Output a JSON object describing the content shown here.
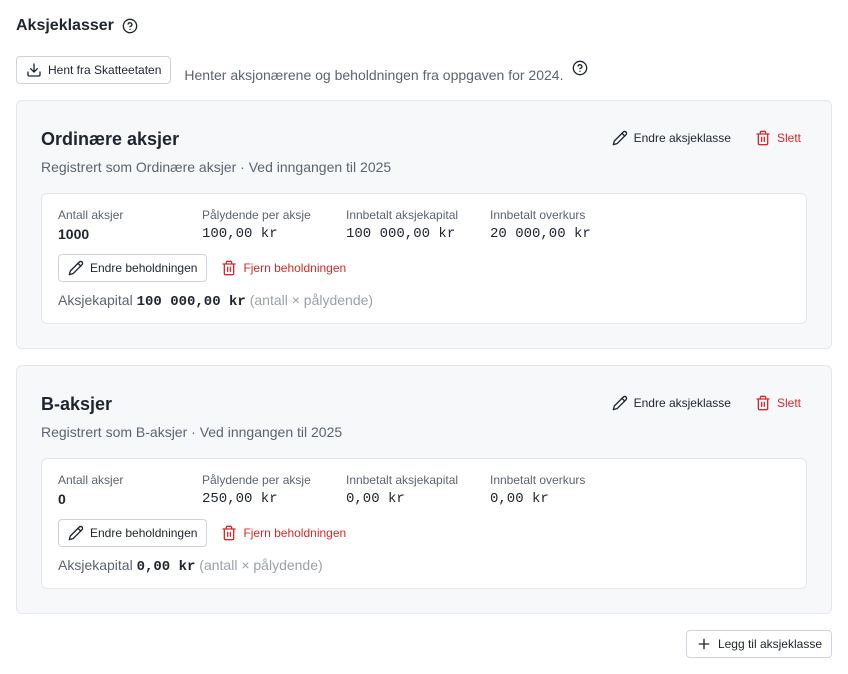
{
  "header": {
    "title": "Aksjeklasser"
  },
  "fetch": {
    "button_label": "Hent fra Skatteetaten",
    "description": "Henter aksjonærene og beholdningen fra oppgaven for 2024."
  },
  "share_classes": [
    {
      "title": "Ordinære aksjer",
      "subtitle": "Registrert som Ordinære aksjer · Ved inngangen til 2025",
      "edit_label": "Endre aksjeklasse",
      "delete_label": "Slett",
      "fields": {
        "count_label": "Antall aksjer",
        "count_value": "1000",
        "par_label": "Pålydende per aksje",
        "par_value": "100,00 kr",
        "paid_capital_label": "Innbetalt aksjekapital",
        "paid_capital_value": "100 000,00 kr",
        "premium_label": "Innbetalt overkurs",
        "premium_value": "20 000,00 kr"
      },
      "edit_holding_label": "Endre beholdningen",
      "remove_holding_label": "Fjern beholdningen",
      "capital_label": "Aksjekapital",
      "capital_value": "100 000,00 kr",
      "capital_note": "(antall × pålydende)"
    },
    {
      "title": "B-aksjer",
      "subtitle": "Registrert som B-aksjer · Ved inngangen til 2025",
      "edit_label": "Endre aksjeklasse",
      "delete_label": "Slett",
      "fields": {
        "count_label": "Antall aksjer",
        "count_value": "0",
        "par_label": "Pålydende per aksje",
        "par_value": "250,00 kr",
        "paid_capital_label": "Innbetalt aksjekapital",
        "paid_capital_value": "0,00 kr",
        "premium_label": "Innbetalt overkurs",
        "premium_value": "0,00 kr"
      },
      "edit_holding_label": "Endre beholdningen",
      "remove_holding_label": "Fjern beholdningen",
      "capital_label": "Aksjekapital",
      "capital_value": "0,00 kr",
      "capital_note": "(antall × pålydende)"
    }
  ],
  "add_button_label": "Legg til aksjeklasse",
  "icons": {
    "help": "help-circle-icon",
    "download": "download-icon",
    "edit": "pencil-icon",
    "delete": "trash-icon",
    "add": "plus-icon"
  },
  "colors": {
    "danger": "#d42a2a",
    "text": "#1e2430",
    "muted": "#5b6472"
  }
}
